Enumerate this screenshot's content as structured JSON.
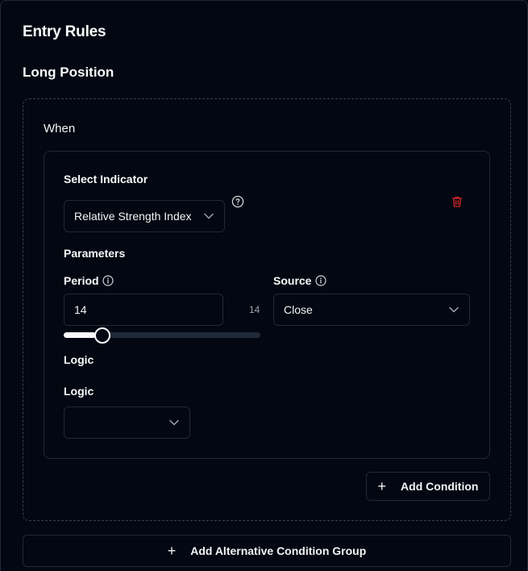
{
  "header": {
    "title": "Entry Rules",
    "position_title": "Long Position"
  },
  "group": {
    "when_label": "When",
    "condition": {
      "indicator_label": "Select Indicator",
      "indicator_value": "Relative Strength Index",
      "help_icon": "help-circle-icon",
      "delete_icon": "trash-icon",
      "parameters_label": "Parameters",
      "period": {
        "label": "Period",
        "value": "14",
        "slider_value": "14",
        "slider_fraction": 0.16
      },
      "source": {
        "label": "Source",
        "value": "Close"
      },
      "logic_section_label": "Logic",
      "logic": {
        "label": "Logic",
        "value": ""
      }
    },
    "add_condition_label": "Add Condition"
  },
  "add_group_label": "Add Alternative Condition Group",
  "colors": {
    "background": "#030712",
    "border": "#1f2937",
    "danger": "#dc2626",
    "text": "#f3f4f6",
    "muted": "#9ca3af"
  }
}
